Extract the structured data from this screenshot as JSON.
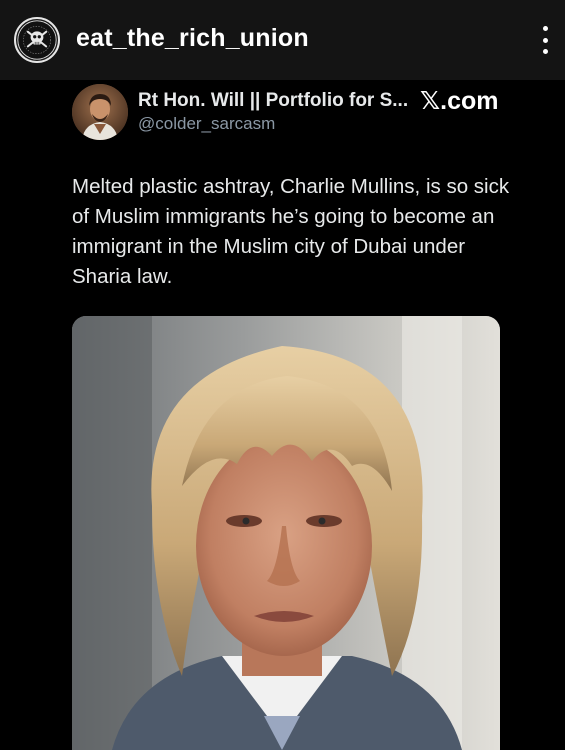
{
  "header": {
    "account_name": "eat_the_rich_union",
    "avatar_icon": "skull-crossbones-logo-icon",
    "menu_icon": "more-vertical-icon"
  },
  "tweet": {
    "display_name": "Rt Hon. Will || Portfolio for S...",
    "handle": "@colder_sarcasm",
    "source": "𝕏.com",
    "text": "Melted plastic ashtray, Charlie Mullins, is so sick of Muslim immigrants he’s going to become an immigrant in the Muslim city of Dubai under Sharia law.",
    "photo": "portrait-photo"
  },
  "colors": {
    "background": "#000000",
    "header_bg": "#141414",
    "text_primary": "#e7e9ea",
    "text_secondary": "#8b98a5"
  }
}
